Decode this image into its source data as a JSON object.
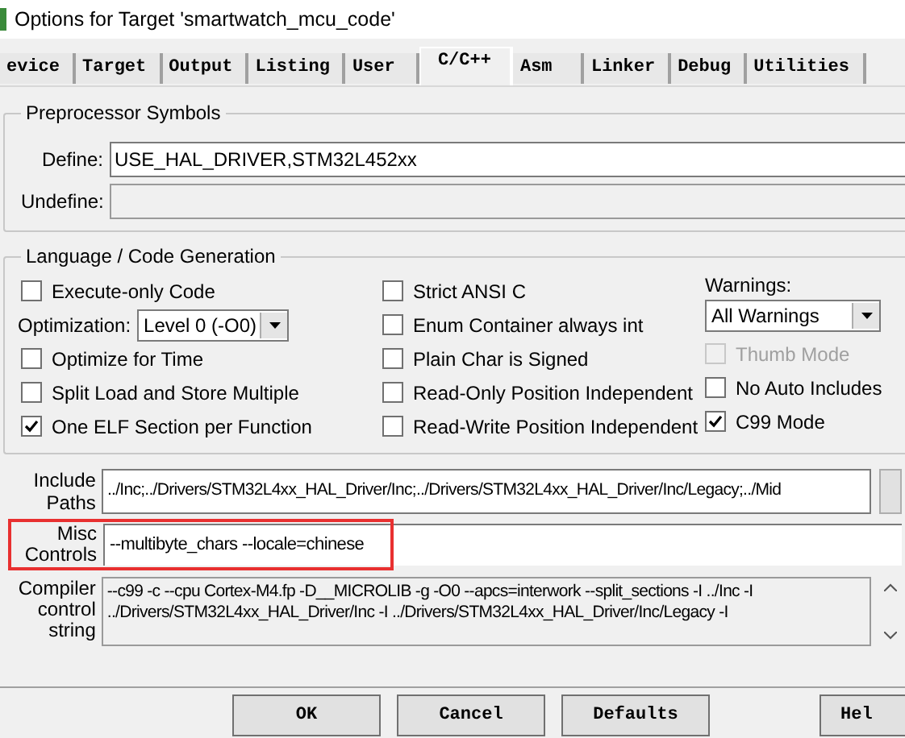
{
  "window": {
    "title": "Options for Target 'smartwatch_mcu_code'"
  },
  "tabs": [
    {
      "label": "evice",
      "selected": false
    },
    {
      "label": "Target",
      "selected": false
    },
    {
      "label": "Output",
      "selected": false
    },
    {
      "label": "Listing",
      "selected": false
    },
    {
      "label": "User",
      "selected": false
    },
    {
      "label": "C/C++",
      "selected": true
    },
    {
      "label": "Asm",
      "selected": false
    },
    {
      "label": "Linker",
      "selected": false
    },
    {
      "label": "Debug",
      "selected": false
    },
    {
      "label": "Utilities",
      "selected": false
    }
  ],
  "preprocessor": {
    "title": "Preprocessor Symbols",
    "define_label": "Define:",
    "define_value": "USE_HAL_DRIVER,STM32L452xx",
    "undefine_label": "Undefine:"
  },
  "language": {
    "title": "Language / Code Generation",
    "column_1": [
      {
        "kind": "checkbox",
        "label": "Execute-only Code",
        "checked": false,
        "disabled": false
      },
      {
        "kind": "dropdown",
        "label": "Optimization:",
        "value": "Level 0 (-O0)"
      },
      {
        "kind": "checkbox",
        "label": "Optimize for Time",
        "checked": false,
        "disabled": false
      },
      {
        "kind": "checkbox",
        "label": "Split Load and Store Multiple",
        "checked": false,
        "disabled": false
      },
      {
        "kind": "checkbox",
        "label": "One ELF Section per Function",
        "checked": true,
        "disabled": false
      }
    ],
    "column_2": [
      {
        "kind": "checkbox",
        "label": "Strict ANSI C",
        "checked": false,
        "disabled": false
      },
      {
        "kind": "checkbox",
        "label": "Enum Container always int",
        "checked": false,
        "disabled": false
      },
      {
        "kind": "checkbox",
        "label": "Plain Char is Signed",
        "checked": false,
        "disabled": false
      },
      {
        "kind": "checkbox",
        "label": "Read-Only Position Independent",
        "checked": false,
        "disabled": false
      },
      {
        "kind": "checkbox",
        "label": "Read-Write Position Independent",
        "checked": false,
        "disabled": false
      }
    ],
    "warnings_label": "Warnings:",
    "warnings_value": "All Warnings",
    "column_3": [
      {
        "kind": "checkbox",
        "label": "Thumb Mode",
        "checked": false,
        "disabled": true
      },
      {
        "kind": "checkbox",
        "label": "No Auto Includes",
        "checked": false,
        "disabled": false
      },
      {
        "kind": "checkbox",
        "label": "C99 Mode",
        "checked": true,
        "disabled": false
      }
    ]
  },
  "include_paths": {
    "label": "Include Paths",
    "value": "../Inc;../Drivers/STM32L4xx_HAL_Driver/Inc;../Drivers/STM32L4xx_HAL_Driver/Inc/Legacy;../Mid"
  },
  "misc_controls": {
    "label": "Misc Controls",
    "value": "--multibyte_chars --locale=chinese",
    "highlighted": true
  },
  "compiler_string": {
    "label": "Compiler control string",
    "value": "--c99 -c --cpu Cortex-M4.fp -D__MICROLIB -g -O0 --apcs=interwork --split_sections -I ../Inc -I ../Drivers/STM32L4xx_HAL_Driver/Inc -I ../Drivers/STM32L4xx_HAL_Driver/Inc/Legacy -I"
  },
  "buttons": [
    "OK",
    "Cancel",
    "Defaults",
    "Hel"
  ]
}
